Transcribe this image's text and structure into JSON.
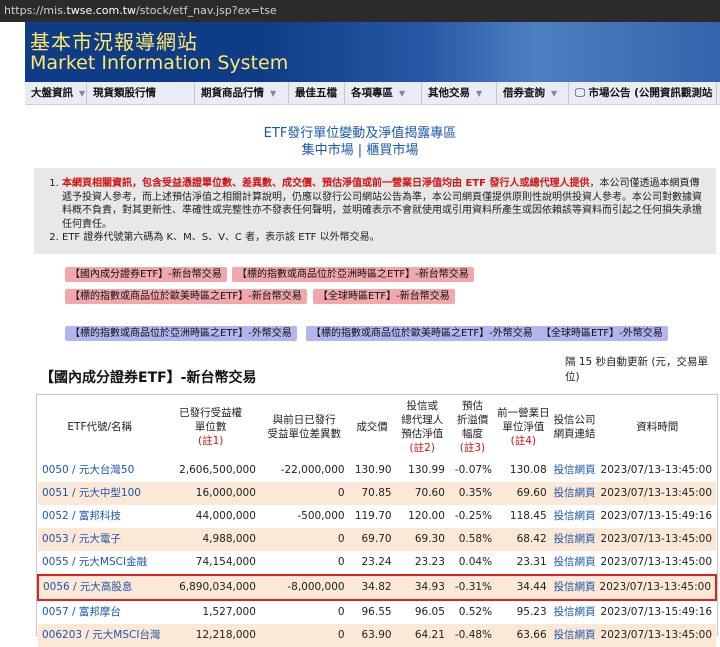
{
  "browser": {
    "url_prefix": "https://mis.",
    "url_domain": "twse.com.tw",
    "url_suffix": "/stock/etf_nav.jsp?ex=tse"
  },
  "banner": {
    "title_zh": "基本市況報導網站",
    "title_en": "Market Information System"
  },
  "nav": [
    {
      "label": "大盤資訊",
      "dropdown": true
    },
    {
      "label": "現貨類股行情",
      "dropdown": false
    },
    {
      "label": "期貨商品行情",
      "dropdown": true
    },
    {
      "label": "最佳五檔",
      "dropdown": false
    },
    {
      "label": "各項專區",
      "dropdown": true
    },
    {
      "label": "其他交易",
      "dropdown": true
    },
    {
      "label": "借券查詢",
      "dropdown": true
    },
    {
      "label": "市場公告 (公開資訊觀測站",
      "dropdown": false,
      "icon": "monitor-icon"
    }
  ],
  "page": {
    "heading": "ETF發行單位變動及淨值揭露專區",
    "market_tse": "集中市場",
    "separator": " | ",
    "market_otc": "櫃買市場"
  },
  "notice": {
    "item1_red": "本網頁相關資訊，包含受益憑證單位數、差異數、成交價、預估淨值或前一營業日淨值均由 ETF 發行人或總代理人提供",
    "item1_rest": "，本公司僅透過本網頁傳遞予投資人參考，而上述預估淨值之相關計算說明，仍應以發行公司網站公告為準，本公司網頁僅提供原則性說明供投資人參考。本公司對數據資料概不負責，對其更新性、準確性或完整性亦不發表任何聲明，並明確表示不會就使用或引用資料所產生或因依賴該等資料而引起之任何損失承擔任何責任。",
    "item2": "ETF 證券代號第六碼為 K、M、S、V、C 者，表示該 ETF 以外幣交易。"
  },
  "filters": {
    "row1": [
      "【國內成分證券ETF】-新台幣交易",
      "【標的指數或商品位於亞洲時區之ETF】-新台幣交易"
    ],
    "row2": [
      "【標的指數或商品位於歐美時區之ETF】-新台幣交易",
      "【全球時區ETF】-新台幣交易"
    ],
    "row3": [
      "【標的指數或商品位於亞洲時區之ETF】-外幣交易",
      "【標的指數或商品位於歐美時區之ETF】-外幣交易",
      "【全球時區ETF】-外幣交易"
    ]
  },
  "refresh_note": "隔 15 秒自動更新 (元，交易單位)",
  "section_title": "【國內成分證券ETF】-新台幣交易",
  "table": {
    "headers": [
      {
        "lines": [
          "ETF代號/名稱"
        ],
        "note": ""
      },
      {
        "lines": [
          "已發行受益權",
          "單位數"
        ],
        "note": "(註1)"
      },
      {
        "lines": [
          "與前日已發行",
          "受益單位差異數"
        ],
        "note": ""
      },
      {
        "lines": [
          "成交價"
        ],
        "note": ""
      },
      {
        "lines": [
          "投信或",
          "總代理人",
          "預估淨值"
        ],
        "note": "(註2)"
      },
      {
        "lines": [
          "預估",
          "折溢價",
          "幅度"
        ],
        "note": "(註3)"
      },
      {
        "lines": [
          "前一營業日",
          "單位淨值"
        ],
        "note": "(註4)"
      },
      {
        "lines": [
          "投信公司",
          "網頁連結"
        ],
        "note": ""
      },
      {
        "lines": [
          "資料時間"
        ],
        "note": ""
      }
    ],
    "rows": [
      {
        "name": "0050 / 元大台灣50",
        "units": "2,606,500,000",
        "diff": "-22,000,000",
        "price": "130.90",
        "nav": "130.99",
        "premium": "-0.07%",
        "prev_nav": "130.08",
        "link": "投信網頁",
        "time": "2023/07/13-13:45:00"
      },
      {
        "name": "0051 / 元大中型100",
        "units": "16,000,000",
        "diff": "0",
        "price": "70.85",
        "nav": "70.60",
        "premium": "0.35%",
        "prev_nav": "69.60",
        "link": "投信網頁",
        "time": "2023/07/13-13:45:00"
      },
      {
        "name": "0052 / 富邦科技",
        "units": "44,000,000",
        "diff": "-500,000",
        "price": "119.70",
        "nav": "120.00",
        "premium": "-0.25%",
        "prev_nav": "118.45",
        "link": "投信網頁",
        "time": "2023/07/13-15:49:16"
      },
      {
        "name": "0053 / 元大電子",
        "units": "4,988,000",
        "diff": "0",
        "price": "69.70",
        "nav": "69.30",
        "premium": "0.58%",
        "prev_nav": "68.42",
        "link": "投信網頁",
        "time": "2023/07/13-13:45:00"
      },
      {
        "name": "0055 / 元大MSCI金融",
        "units": "74,154,000",
        "diff": "0",
        "price": "23.24",
        "nav": "23.23",
        "premium": "0.04%",
        "prev_nav": "23.31",
        "link": "投信網頁",
        "time": "2023/07/13-13:45:00"
      },
      {
        "name": "0056 / 元大高股息",
        "units": "6,890,034,000",
        "diff": "-8,000,000",
        "price": "34.82",
        "nav": "34.93",
        "premium": "-0.31%",
        "prev_nav": "34.44",
        "link": "投信網頁",
        "time": "2023/07/13-13:45:00",
        "highlight": true
      },
      {
        "name": "0057 / 富邦摩台",
        "units": "1,527,000",
        "diff": "0",
        "price": "96.55",
        "nav": "96.05",
        "premium": "0.52%",
        "prev_nav": "95.23",
        "link": "投信網頁",
        "time": "2023/07/13-15:49:16"
      },
      {
        "name": "006203 / 元大MSCI台灣",
        "units": "12,218,000",
        "diff": "0",
        "price": "63.90",
        "nav": "64.21",
        "premium": "-0.48%",
        "prev_nav": "63.66",
        "link": "投信網頁",
        "time": "2023/07/13-13:45:00"
      }
    ]
  }
}
